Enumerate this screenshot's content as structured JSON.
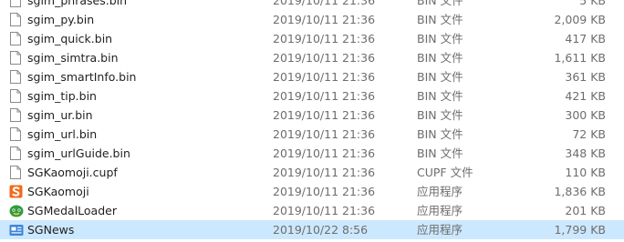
{
  "files": [
    {
      "name": "sgim_phrases.bin",
      "date": "2019/10/11 21:36",
      "type": "BIN 文件",
      "size": "5 KB",
      "icon": "document-icon"
    },
    {
      "name": "sgim_py.bin",
      "date": "2019/10/11 21:36",
      "type": "BIN 文件",
      "size": "2,009 KB",
      "icon": "document-icon"
    },
    {
      "name": "sgim_quick.bin",
      "date": "2019/10/11 21:36",
      "type": "BIN 文件",
      "size": "417 KB",
      "icon": "document-icon"
    },
    {
      "name": "sgim_simtra.bin",
      "date": "2019/10/11 21:36",
      "type": "BIN 文件",
      "size": "1,611 KB",
      "icon": "document-icon"
    },
    {
      "name": "sgim_smartInfo.bin",
      "date": "2019/10/11 21:36",
      "type": "BIN 文件",
      "size": "361 KB",
      "icon": "document-icon"
    },
    {
      "name": "sgim_tip.bin",
      "date": "2019/10/11 21:36",
      "type": "BIN 文件",
      "size": "421 KB",
      "icon": "document-icon"
    },
    {
      "name": "sgim_ur.bin",
      "date": "2019/10/11 21:36",
      "type": "BIN 文件",
      "size": "300 KB",
      "icon": "document-icon"
    },
    {
      "name": "sgim_url.bin",
      "date": "2019/10/11 21:36",
      "type": "BIN 文件",
      "size": "72 KB",
      "icon": "document-icon"
    },
    {
      "name": "sgim_urlGuide.bin",
      "date": "2019/10/11 21:36",
      "type": "BIN 文件",
      "size": "348 KB",
      "icon": "document-icon"
    },
    {
      "name": "SGKaomoji.cupf",
      "date": "2019/10/11 21:36",
      "type": "CUPF 文件",
      "size": "110 KB",
      "icon": "document-icon"
    },
    {
      "name": "SGKaomoji",
      "date": "2019/10/11 21:36",
      "type": "应用程序",
      "size": "1,836 KB",
      "icon": "sogou-s-icon"
    },
    {
      "name": "SGMedalLoader",
      "date": "2019/10/11 21:36",
      "type": "应用程序",
      "size": "201 KB",
      "icon": "medal-icon"
    },
    {
      "name": "SGNews",
      "date": "2019/10/22 8:56",
      "type": "应用程序",
      "size": "1,799 KB",
      "icon": "news-icon",
      "selected": true
    }
  ],
  "colors": {
    "selection": "#cce8ff",
    "secondary_text": "#6d6d6d",
    "sogou_orange": "#f26a1b",
    "medal_green": "#2e9e3e",
    "news_blue": "#3c86d8"
  }
}
